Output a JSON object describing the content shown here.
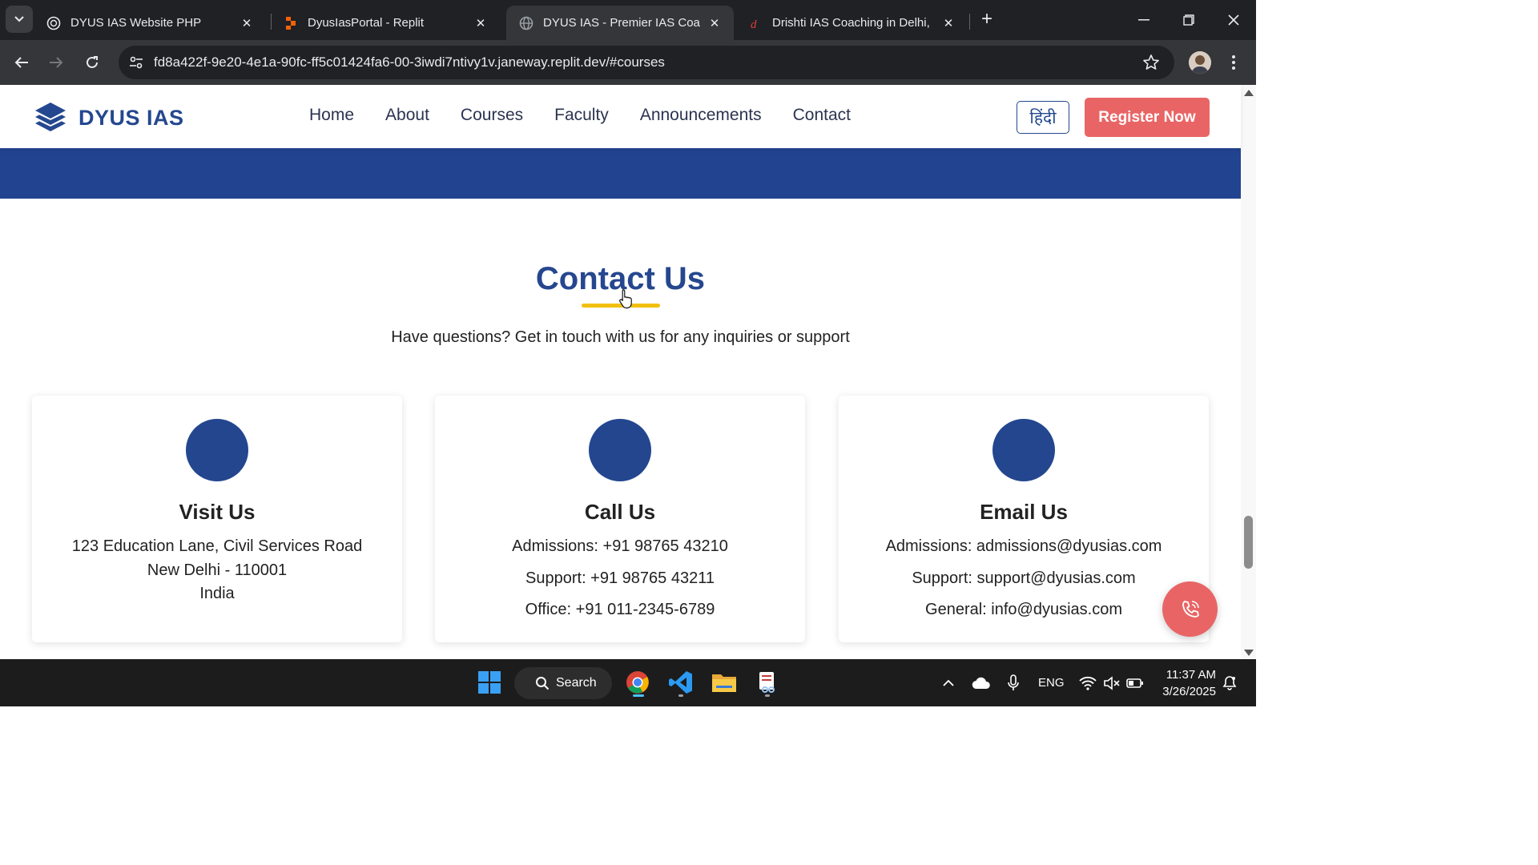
{
  "browser": {
    "tabs": [
      {
        "title": "DYUS IAS Website PHP",
        "icon": "openai-icon"
      },
      {
        "title": "DyusIasPortal - Replit",
        "icon": "replit-icon"
      },
      {
        "title": "DYUS IAS - Premier IAS Coachir",
        "icon": "globe-icon",
        "active": true
      },
      {
        "title": "Drishti IAS Coaching in Delhi, Be",
        "icon": "drishti-icon"
      }
    ],
    "close_glyph": "✕",
    "new_tab_glyph": "+",
    "url": "fd8a422f-9e20-4e1a-90fc-ff5c01424fa6-00-3iwdi7ntivy1v.janeway.replit.dev/#courses"
  },
  "site": {
    "brand": "DYUS IAS",
    "menu": [
      "Home",
      "About",
      "Courses",
      "Faculty",
      "Announcements",
      "Contact"
    ],
    "lang_button": "हिंदी",
    "register_button": "Register Now",
    "colors": {
      "primary": "#22438f",
      "accent": "#e96565",
      "underline": "#f2c011"
    }
  },
  "contact": {
    "title": "Contact Us",
    "subtitle": "Have questions? Get in touch with us for any inquiries or support",
    "cards": [
      {
        "heading": "Visit Us",
        "lines": [
          "123 Education Lane, Civil Services Road",
          "New Delhi - 110001",
          "India"
        ]
      },
      {
        "heading": "Call Us",
        "lines": [
          "Admissions: +91 98765 43210",
          "Support: +91 98765 43211",
          "Office: +91 011-2345-6789"
        ]
      },
      {
        "heading": "Email Us",
        "lines": [
          "Admissions: admissions@dyusias.com",
          "Support: support@dyusias.com",
          "General: info@dyusias.com"
        ]
      }
    ]
  },
  "taskbar": {
    "search_label": "Search",
    "language": "ENG",
    "time": "11:37 AM",
    "date": "3/26/2025"
  }
}
